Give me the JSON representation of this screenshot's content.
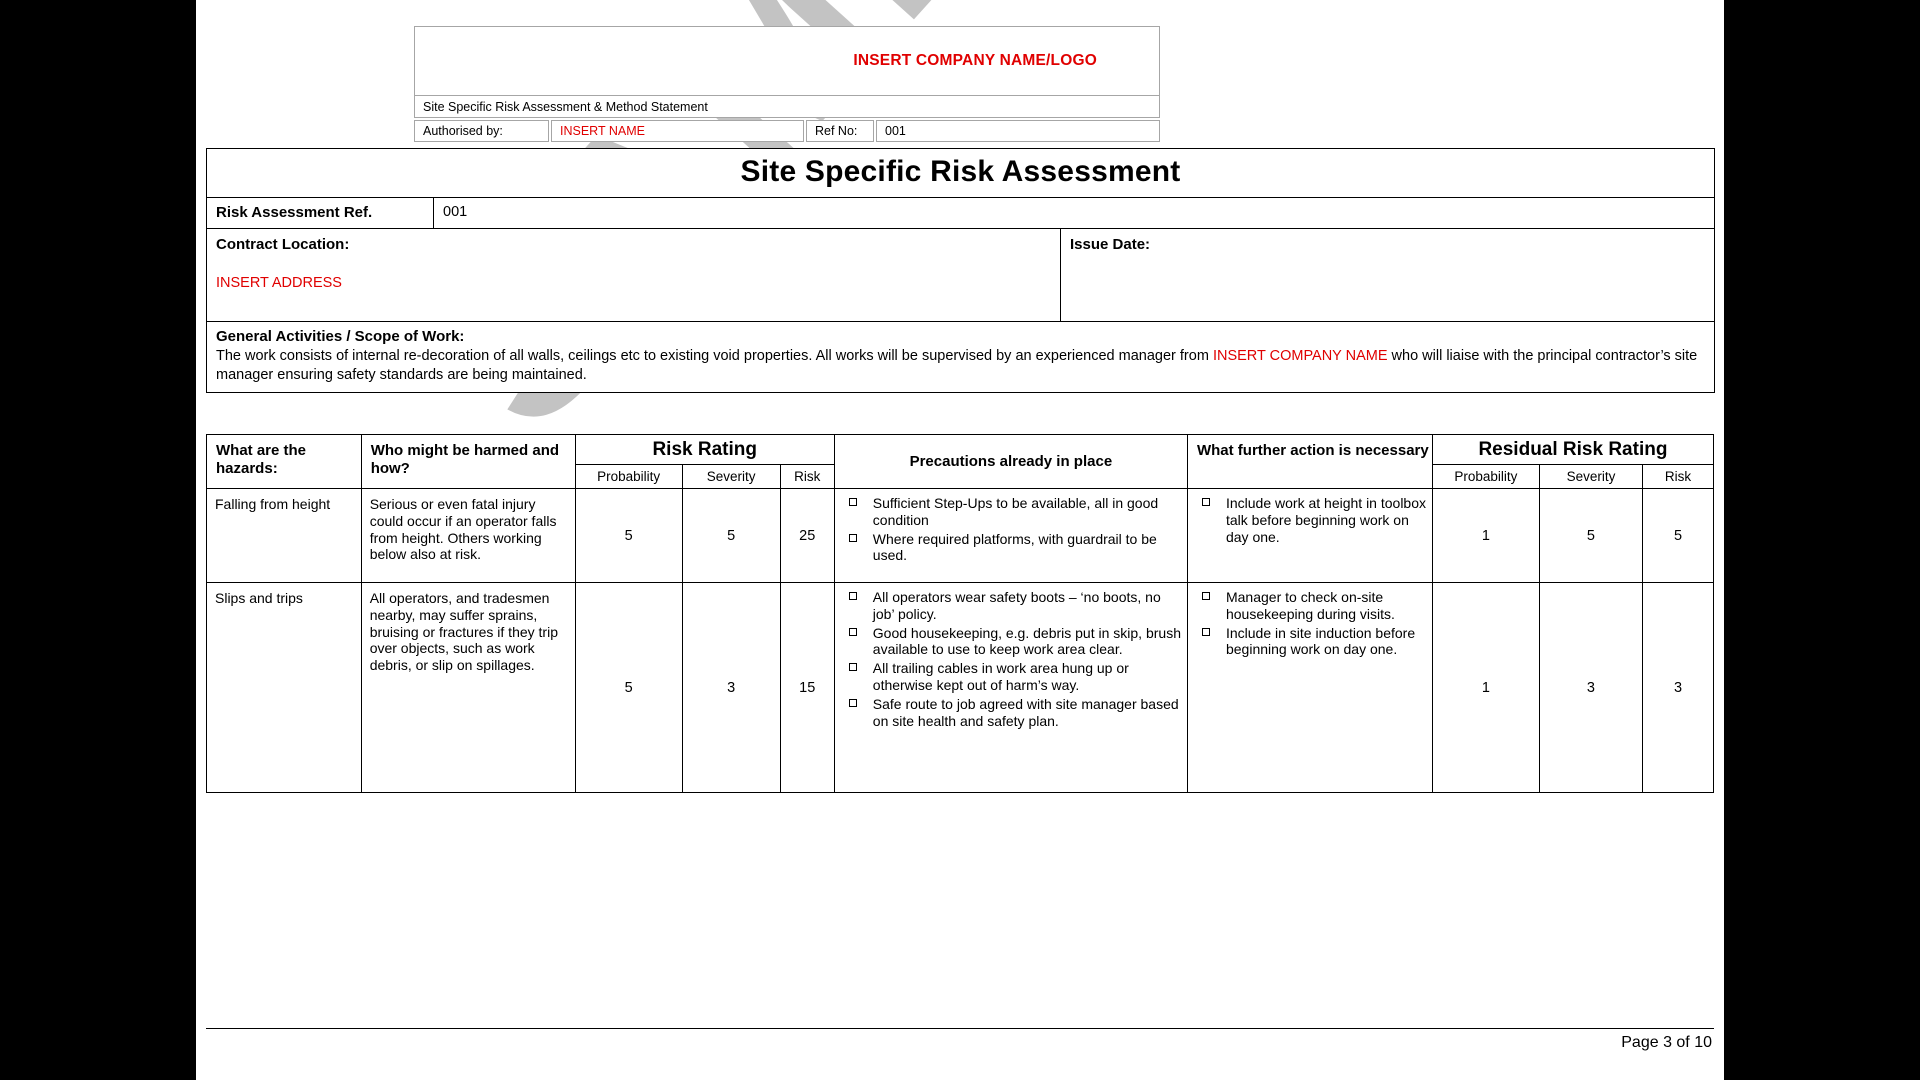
{
  "document": {
    "watermark_text": "SAMPLE"
  },
  "letterhead": {
    "logo_placeholder": "INSERT COMPANY NAME/LOGO",
    "subtitle": "Site Specific Risk Assessment & Method Statement",
    "authorised_by_label": "Authorised by:",
    "authorised_by_value": "INSERT NAME",
    "ref_no_label": "Ref No:",
    "ref_no_value": "001"
  },
  "info": {
    "title": "Site Specific Risk Assessment",
    "ra_ref_label": "Risk Assessment Ref.",
    "ra_ref_value": "001",
    "contract_location_label": "Contract Location:",
    "contract_location_value": "INSERT ADDRESS",
    "issue_date_label": "Issue Date:",
    "issue_date_value": "",
    "scope_label": "General Activities / Scope of Work:",
    "scope_part1": "The work consists of internal re-decoration of all walls, ceilings etc to existing void properties. All works will be supervised by an experienced manager from ",
    "scope_red1": "INSERT COMPANY NAME",
    "scope_part2": " who will liaise with the principal contractor’s site manager ensuring safety standards are being maintained."
  },
  "risk_table": {
    "headers": {
      "hazards": "What are the hazards:",
      "who_harmed": "Who might be harmed and how?",
      "risk_rating": "Risk Rating",
      "precautions": "Precautions already in place",
      "further_action": "What further action is necessary",
      "residual_risk_rating": "Residual Risk Rating",
      "probability": "Probability",
      "severity": "Severity",
      "risk": "Risk"
    },
    "rows": [
      {
        "hazard": "Falling from height",
        "who_harmed": "Serious or even fatal injury could occur if an operator falls from height. Others working below also at risk.",
        "probability": "5",
        "severity": "5",
        "risk": "25",
        "precautions": [
          "Sufficient Step-Ups to be available, all in good condition",
          "Where required platforms, with guardrail to be used."
        ],
        "further_action": [
          "Include work at height in toolbox talk before beginning work on day one."
        ],
        "residual_probability": "1",
        "residual_severity": "5",
        "residual_risk": "5"
      },
      {
        "hazard": "Slips and trips",
        "who_harmed": "All operators, and tradesmen nearby, may suffer sprains, bruising or fractures if they trip over objects, such as work debris, or slip on spillages.",
        "probability": "5",
        "severity": "3",
        "risk": "15",
        "precautions": [
          "All operators wear safety boots – ‘no boots, no job’ policy.",
          "Good housekeeping, e.g. debris put in skip, brush available to use to keep work area clear.",
          "All trailing cables in work area hung up or otherwise kept out of harm’s way.",
          "Safe route to job agreed with site manager based on site health and safety plan."
        ],
        "further_action": [
          "Manager to check on-site housekeeping during visits.",
          "Include in site induction before beginning work on day one."
        ],
        "residual_probability": "1",
        "residual_severity": "3",
        "residual_risk": "3"
      }
    ]
  },
  "footer": {
    "page_text": "Page 3 of 10"
  },
  "colors": {
    "header_grey": "#d9d9d9",
    "header_blue": "#9dc3e6",
    "red_placeholder": "#e00000",
    "watermark_grey": "#c0c0c0"
  }
}
